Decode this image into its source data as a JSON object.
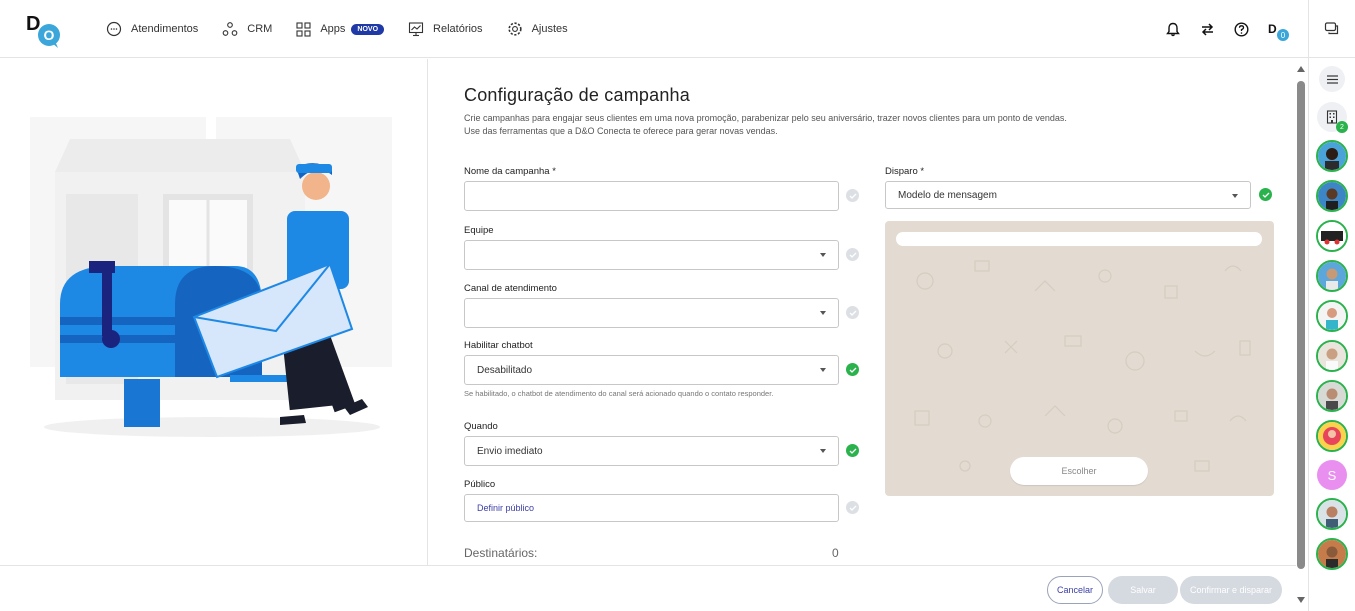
{
  "app": {
    "logo_letters": "DO"
  },
  "nav": {
    "items": [
      {
        "label": "Atendimentos",
        "icon": "chat-bubble-icon"
      },
      {
        "label": "CRM",
        "icon": "crm-nodes-icon"
      },
      {
        "label": "Apps",
        "icon": "apps-grid-icon",
        "badge": "NOVO"
      },
      {
        "label": "Relatórios",
        "icon": "report-chart-icon"
      },
      {
        "label": "Ajustes",
        "icon": "gear-icon"
      }
    ]
  },
  "header_icons": {
    "notifications": "bell-icon",
    "transfer": "swap-arrows-icon",
    "help": "help-icon",
    "status_count": "0"
  },
  "rail": {
    "company_count": "2",
    "avatar_letter": "S"
  },
  "page": {
    "title": "Configuração de campanha",
    "description": "Crie campanhas para engajar seus clientes em uma nova promoção, parabenizar pelo seu aniversário, trazer novos clientes para um ponto de vendas. Use das ferramentas que a D&O Conecta te oferece para gerar novas vendas."
  },
  "form": {
    "nome": {
      "label": "Nome da campanha *",
      "value": ""
    },
    "equipe": {
      "label": "Equipe",
      "value": ""
    },
    "canal": {
      "label": "Canal de atendimento",
      "value": ""
    },
    "chatbot": {
      "label": "Habilitar chatbot",
      "value": "Desabilitado",
      "hint": "Se habilitado, o chatbot de atendimento do canal será acionado quando o contato responder."
    },
    "quando": {
      "label": "Quando",
      "value": "Envio imediato"
    },
    "publico": {
      "label": "Público",
      "value": "Definir público"
    },
    "destinatarios": {
      "label": "Destinatários:",
      "value": "0"
    },
    "disparo": {
      "label": "Disparo *",
      "value": "Modelo de mensagem"
    },
    "preview": {
      "choose_label": "Escolher"
    }
  },
  "footer": {
    "cancel": "Cancelar",
    "save": "Salvar",
    "confirm": "Confirmar e disparar"
  },
  "colors": {
    "accent": "#3b3ea5",
    "success": "#2ab24c",
    "brand_teal": "#3aa6d9",
    "badge": "#1f3aa6"
  }
}
